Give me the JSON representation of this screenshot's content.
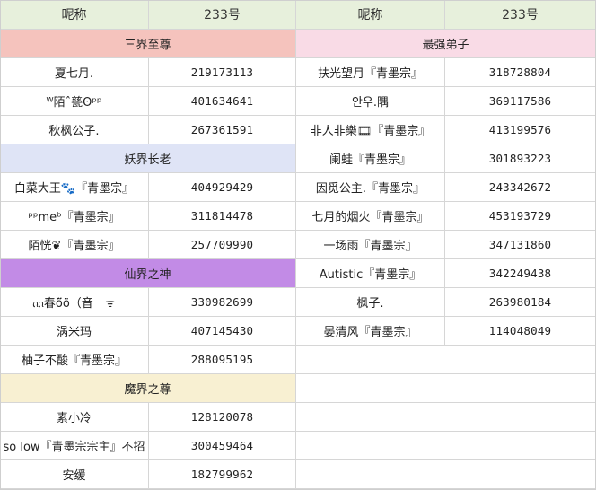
{
  "header": {
    "name_col_left": "昵称",
    "id_col_left": "233号",
    "name_col_right": "昵称",
    "id_col_right": "233号"
  },
  "colors": {
    "header_bg": "#e7f0dc",
    "sec1": "#f5c3bd",
    "sec2": "#dfe4f6",
    "sec3": "#c28be6",
    "sec4": "#f8f0d2",
    "right_sec": "#f9dbe6"
  },
  "left": {
    "sections": [
      {
        "title": "三界至尊",
        "rows": [
          {
            "name": "夏七月.",
            "id": "219173113"
          },
          {
            "name": "ᵂ陌ˆ甆ʘᵖᵖ",
            "id": "401634641"
          },
          {
            "name": "秋枫公子.",
            "id": "267361591"
          }
        ]
      },
      {
        "title": "妖界长老",
        "rows": [
          {
            "name": "白菜大王🐾『青墨宗』",
            "id": "404929429"
          },
          {
            "name": "ᵖᵖmeᵇ『青墨宗』",
            "id": "311814478"
          },
          {
            "name": "陌恍❦『青墨宗』",
            "id": "257709990"
          }
        ]
      },
      {
        "title": "仙界之神",
        "rows": [
          {
            "name": "ᦶ春ö̈ö（音　ᯤ",
            "id": "330982699"
          },
          {
            "name": "涡米玛",
            "id": "407145430"
          },
          {
            "name": "柚子不酸『青墨宗』",
            "id": "288095195"
          }
        ]
      },
      {
        "title": "魔界之尊",
        "rows": [
          {
            "name": "素小冷",
            "id": "128120078"
          },
          {
            "name": "so low『青墨宗宗主』不招",
            "id": "300459464"
          },
          {
            "name": "安缓",
            "id": "182799962"
          }
        ]
      }
    ]
  },
  "right": {
    "title": "最强弟子",
    "rows": [
      {
        "name": "扶光望月『青墨宗』",
        "id": "318728804"
      },
      {
        "name": "안우.隅",
        "id": "369117586"
      },
      {
        "name": "非人非樂🎞『青墨宗』",
        "id": "413199576"
      },
      {
        "name": "阑蛙『青墨宗』",
        "id": "301893223"
      },
      {
        "name": "因觅公主.『青墨宗』",
        "id": "243342672"
      },
      {
        "name": "七月的烟火『青墨宗』",
        "id": "453193729"
      },
      {
        "name": "一场雨『青墨宗』",
        "id": "347131860"
      },
      {
        "name": "Autistic『青墨宗』",
        "id": "342249438"
      },
      {
        "name": "枫子.",
        "id": "263980184"
      },
      {
        "name": "晏清风『青墨宗』",
        "id": "114048049"
      }
    ]
  }
}
